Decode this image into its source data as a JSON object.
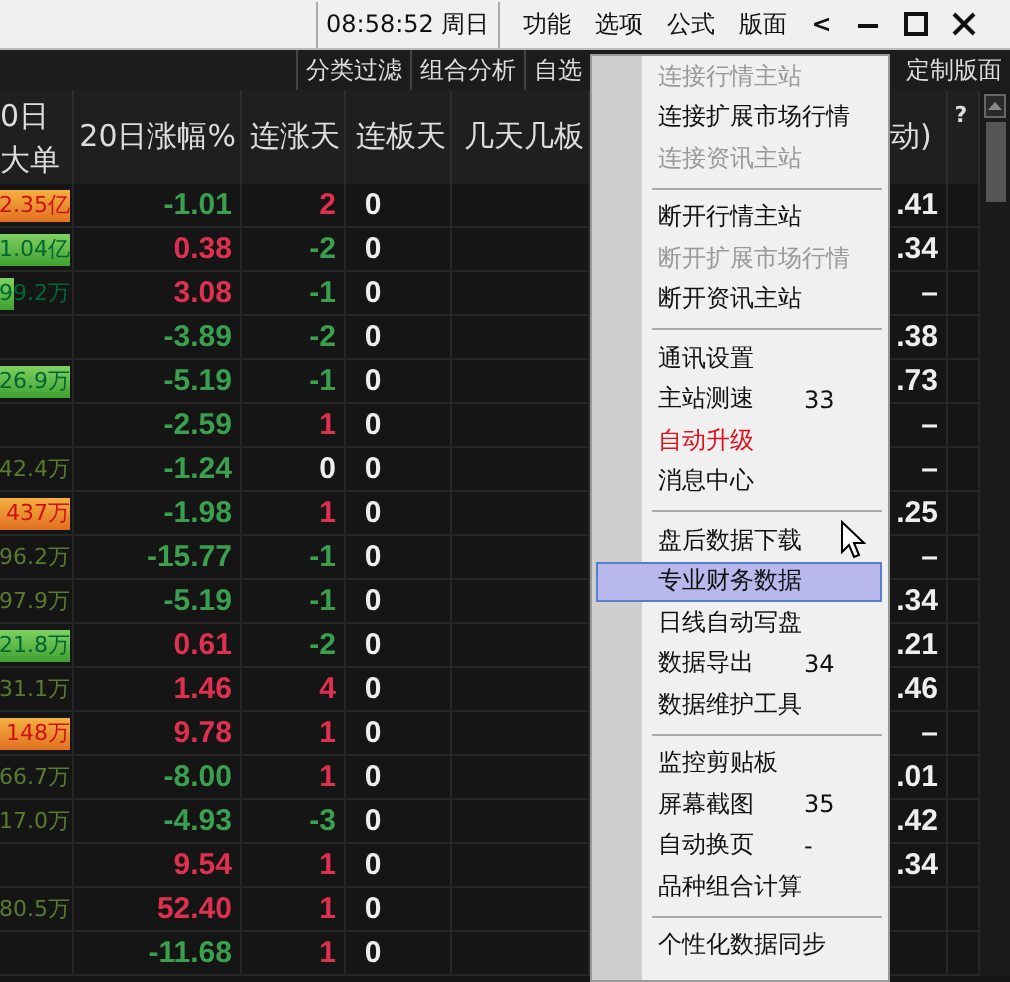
{
  "top_bar": {
    "clock": "08:58:52 周日",
    "menus": [
      "功能",
      "选项",
      "公式",
      "版面"
    ],
    "controls": [
      {
        "kind": "back",
        "label": "<"
      },
      {
        "kind": "minimize"
      },
      {
        "kind": "maximize"
      },
      {
        "kind": "close"
      }
    ]
  },
  "toolbar": {
    "tabs": [
      "分类过滤",
      "组合分析",
      "自选"
    ],
    "right_tab": "定制版面"
  },
  "table": {
    "columns": [
      {
        "label": "0日大单"
      },
      {
        "label": "20日涨幅%"
      },
      {
        "label": "连涨天"
      },
      {
        "label": "连板天"
      },
      {
        "label": "几天几板"
      },
      {
        "label": "动)"
      },
      {
        "label": "?"
      }
    ],
    "rows": [
      {
        "big": {
          "text": "2.35亿",
          "kind": "up",
          "level": 1
        },
        "pct": {
          "text": "-1.01",
          "color": "#3aa050"
        },
        "days": {
          "text": "2",
          "color": "#e03050"
        },
        "boards": "0",
        "right": ".41"
      },
      {
        "big": {
          "text": "1.04亿",
          "kind": "down",
          "level": 1
        },
        "pct": {
          "text": "0.38",
          "color": "#e03050"
        },
        "days": {
          "text": "-2",
          "color": "#3aa050"
        },
        "boards": "0",
        "right": ".34"
      },
      {
        "big": {
          "text": "99.2万",
          "kind": "down",
          "level": 0.2
        },
        "pct": {
          "text": "3.08",
          "color": "#e03050"
        },
        "days": {
          "text": "-1",
          "color": "#3aa050"
        },
        "boards": "0",
        "right": "–"
      },
      {
        "pct": {
          "text": "-3.89",
          "color": "#3aa050"
        },
        "days": {
          "text": "-2",
          "color": "#3aa050"
        },
        "boards": "0",
        "right": ".38"
      },
      {
        "big": {
          "text": "26.9万",
          "kind": "down",
          "level": 1
        },
        "pct": {
          "text": "-5.19",
          "color": "#3aa050"
        },
        "days": {
          "text": "-1",
          "color": "#3aa050"
        },
        "boards": "0",
        "right": ".73"
      },
      {
        "pct": {
          "text": "-2.59",
          "color": "#3aa050"
        },
        "days": {
          "text": "1",
          "color": "#e03050"
        },
        "boards": "0",
        "right": "–"
      },
      {
        "big": {
          "text": "42.4万",
          "kind": "plain"
        },
        "pct": {
          "text": "-1.24",
          "color": "#3aa050"
        },
        "days": {
          "text": "0",
          "color": "#eeeeee"
        },
        "boards": "0",
        "right": "–"
      },
      {
        "big": {
          "text": "437万",
          "kind": "up",
          "level": 1
        },
        "pct": {
          "text": "-1.98",
          "color": "#3aa050"
        },
        "days": {
          "text": "1",
          "color": "#e03050"
        },
        "boards": "0",
        "right": ".25"
      },
      {
        "big": {
          "text": "96.2万",
          "kind": "plain"
        },
        "pct": {
          "text": "-15.77",
          "color": "#3aa050"
        },
        "days": {
          "text": "-1",
          "color": "#3aa050"
        },
        "boards": "0",
        "right": "–"
      },
      {
        "big": {
          "text": "97.9万",
          "kind": "plain"
        },
        "pct": {
          "text": "-5.19",
          "color": "#3aa050"
        },
        "days": {
          "text": "-1",
          "color": "#3aa050"
        },
        "boards": "0",
        "right": ".34"
      },
      {
        "big": {
          "text": "21.8万",
          "kind": "down",
          "level": 1
        },
        "pct": {
          "text": "0.61",
          "color": "#e03050"
        },
        "days": {
          "text": "-2",
          "color": "#3aa050"
        },
        "boards": "0",
        "right": ".21"
      },
      {
        "big": {
          "text": "31.1万",
          "kind": "plain"
        },
        "pct": {
          "text": "1.46",
          "color": "#e03050"
        },
        "days": {
          "text": "4",
          "color": "#e03050"
        },
        "boards": "0",
        "right": ".46"
      },
      {
        "big": {
          "text": "148万",
          "kind": "up",
          "level": 1
        },
        "pct": {
          "text": "9.78",
          "color": "#e03050"
        },
        "days": {
          "text": "1",
          "color": "#e03050"
        },
        "boards": "0",
        "right": "–"
      },
      {
        "big": {
          "text": "66.7万",
          "kind": "plain"
        },
        "pct": {
          "text": "-8.00",
          "color": "#3aa050"
        },
        "days": {
          "text": "1",
          "color": "#e03050"
        },
        "boards": "0",
        "right": ".01"
      },
      {
        "big": {
          "text": "17.0万",
          "kind": "plain"
        },
        "pct": {
          "text": "-4.93",
          "color": "#3aa050"
        },
        "days": {
          "text": "-3",
          "color": "#3aa050"
        },
        "boards": "0",
        "right": ".42"
      },
      {
        "pct": {
          "text": "9.54",
          "color": "#e03050"
        },
        "days": {
          "text": "1",
          "color": "#e03050"
        },
        "boards": "0",
        "right": ".34"
      },
      {
        "big": {
          "text": "80.5万",
          "kind": "plain"
        },
        "pct": {
          "text": "52.40",
          "color": "#e03050"
        },
        "days": {
          "text": "1",
          "color": "#e03050"
        },
        "boards": "0"
      },
      {
        "pct": {
          "text": "-11.68",
          "color": "#3aa050"
        },
        "days": {
          "text": "1",
          "color": "#e03050"
        },
        "boards": "0"
      }
    ]
  },
  "menu": {
    "items": [
      {
        "kind": "item",
        "label": "连接行情主站",
        "disabled": true,
        "selected": false
      },
      {
        "kind": "item",
        "label": "连接扩展市场行情",
        "disabled": false,
        "selected": false
      },
      {
        "kind": "item",
        "label": "连接资讯主站",
        "disabled": true,
        "selected": false
      },
      {
        "kind": "separator"
      },
      {
        "kind": "item",
        "label": "断开行情主站",
        "disabled": false,
        "selected": false
      },
      {
        "kind": "item",
        "label": "断开扩展市场行情",
        "disabled": true,
        "selected": false
      },
      {
        "kind": "item",
        "label": "断开资讯主站",
        "disabled": false,
        "selected": false
      },
      {
        "kind": "separator"
      },
      {
        "kind": "item",
        "label": "通讯设置",
        "disabled": false,
        "selected": false
      },
      {
        "kind": "item",
        "label": "主站测速",
        "shortcut": "33",
        "disabled": false,
        "selected": false
      },
      {
        "kind": "item",
        "label": "自动升级",
        "warning": true,
        "disabled": false,
        "selected": false
      },
      {
        "kind": "item",
        "label": "消息中心",
        "disabled": false,
        "selected": false
      },
      {
        "kind": "separator"
      },
      {
        "kind": "item",
        "label": "盘后数据下载",
        "disabled": false,
        "selected": false
      },
      {
        "kind": "item",
        "label": "专业财务数据",
        "disabled": false,
        "selected": true
      },
      {
        "kind": "item",
        "label": "日线自动写盘",
        "disabled": false,
        "selected": false
      },
      {
        "kind": "item",
        "label": "数据导出",
        "shortcut": "34",
        "disabled": false,
        "selected": false
      },
      {
        "kind": "item",
        "label": "数据维护工具",
        "disabled": false,
        "selected": false
      },
      {
        "kind": "separator"
      },
      {
        "kind": "item",
        "label": "监控剪贴板",
        "disabled": false,
        "selected": false
      },
      {
        "kind": "item",
        "label": "屏幕截图",
        "shortcut": "35",
        "disabled": false,
        "selected": false
      },
      {
        "kind": "item",
        "label": "自动换页",
        "shortcut": "-",
        "disabled": false,
        "selected": false
      },
      {
        "kind": "item",
        "label": "品种组合计算",
        "disabled": false,
        "selected": false
      },
      {
        "kind": "separator"
      },
      {
        "kind": "item",
        "label": "个性化数据同步",
        "disabled": false,
        "selected": false
      }
    ]
  }
}
